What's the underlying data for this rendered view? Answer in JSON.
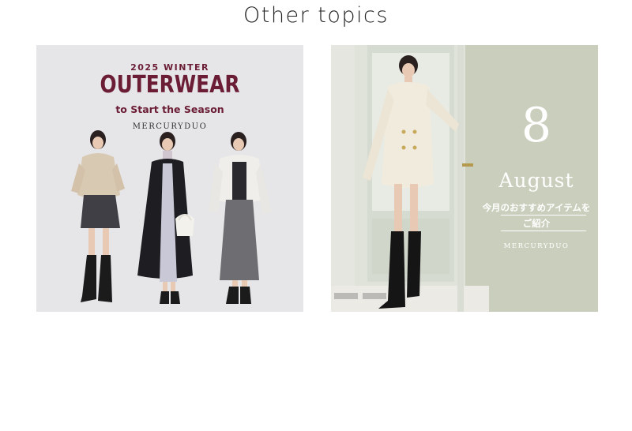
{
  "section": {
    "title": "Other topics"
  },
  "cards": [
    {
      "kicker": "2025 WINTER",
      "headline": "OUTERWEAR",
      "subline": "to Start the Season",
      "brand": "MERCURYDUO",
      "accent_color": "#6b1d35",
      "background_color": "#e6e6e8"
    },
    {
      "day": "8",
      "month": "August",
      "line1": "今月のおすすめアイテムを",
      "line2": "ご紹介",
      "brand": "MERCURYDUO",
      "background_color": "#c9cfbc"
    }
  ]
}
